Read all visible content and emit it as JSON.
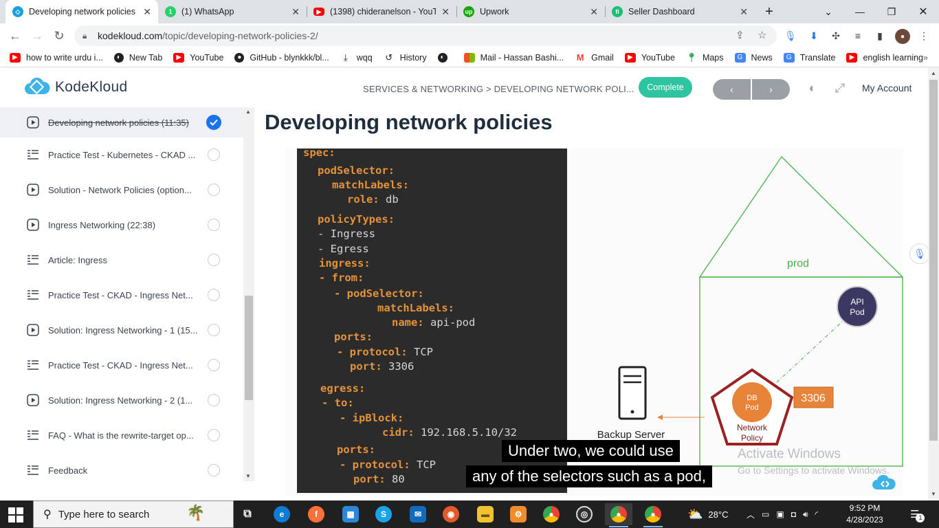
{
  "browser": {
    "tabs": [
      {
        "title": "Developing network policies",
        "active": true,
        "icon": "kodekloud-icon",
        "color": "#1a9ee0"
      },
      {
        "title": "(1) WhatsApp",
        "active": false,
        "icon": "whatsapp-icon",
        "color": "#25d366"
      },
      {
        "title": "(1398) chideranelson - YouTu",
        "active": false,
        "icon": "youtube-icon",
        "color": "#ff0000"
      },
      {
        "title": "Upwork",
        "active": false,
        "icon": "upwork-icon",
        "color": "#14a800"
      },
      {
        "title": "Seller Dashboard",
        "active": false,
        "icon": "fiverr-icon",
        "color": "#1dbf73"
      }
    ],
    "url_host": "kodekloud.com",
    "url_path": "/topic/developing-network-policies-2/",
    "bookmarks": [
      {
        "label": "how to write urdu i...",
        "icon": "youtube-icon",
        "color": "#ff0000"
      },
      {
        "label": "New Tab",
        "icon": "globe-icon",
        "color": "#202124"
      },
      {
        "label": "YouTube",
        "icon": "youtube-icon",
        "color": "#ff0000"
      },
      {
        "label": "GitHub - blynkkk/bl...",
        "icon": "github-icon",
        "color": "#202124"
      },
      {
        "label": "wqq",
        "icon": "download-icon",
        "color": "#202124"
      },
      {
        "label": "History",
        "icon": "history-icon",
        "color": "#202124"
      },
      {
        "label": "",
        "icon": "globe-icon",
        "color": "#202124"
      },
      {
        "label": "Mail - Hassan Bashi...",
        "icon": "microsoft-icon",
        "color": "#f25022"
      },
      {
        "label": "Gmail",
        "icon": "gmail-icon",
        "color": "#ea4335"
      },
      {
        "label": "YouTube",
        "icon": "youtube-icon",
        "color": "#ff0000"
      },
      {
        "label": "Maps",
        "icon": "maps-icon",
        "color": "#34a853"
      },
      {
        "label": "News",
        "icon": "news-icon",
        "color": "#4285f4"
      },
      {
        "label": "Translate",
        "icon": "translate-icon",
        "color": "#4285f4"
      },
      {
        "label": "english learning",
        "icon": "youtube-icon",
        "color": "#ff0000"
      }
    ]
  },
  "site": {
    "logo_text": "KodeKloud",
    "breadcrumb": "SERVICES & NETWORKING > DEVELOPING NETWORK POLI...",
    "complete_label": "Complete",
    "prev_label": "‹",
    "next_label": "›",
    "account_label": "My Account",
    "brand_color": "#2ec4a0"
  },
  "sidebar": {
    "items": [
      {
        "label": "Developing network policies (11:35)",
        "type": "video",
        "done": true,
        "active": true
      },
      {
        "label": "Practice Test - Kubernetes - CKAD ...",
        "type": "quiz",
        "done": false
      },
      {
        "label": "Solution - Network Policies (option...",
        "type": "video",
        "done": false
      },
      {
        "label": "Ingress Networking (22:38)",
        "type": "video",
        "done": false
      },
      {
        "label": "Article: Ingress",
        "type": "quiz",
        "done": false
      },
      {
        "label": "Practice Test - CKAD - Ingress Net...",
        "type": "quiz",
        "done": false
      },
      {
        "label": "Solution: Ingress Networking - 1 (15...",
        "type": "video",
        "done": false
      },
      {
        "label": "Practice Test - CKAD - Ingress Net...",
        "type": "quiz",
        "done": false
      },
      {
        "label": "Solution: Ingress Networking - 2 (1...",
        "type": "video",
        "done": false
      },
      {
        "label": "FAQ - What is the rewrite-target op...",
        "type": "quiz",
        "done": false
      },
      {
        "label": "Feedback",
        "type": "quiz",
        "done": false
      }
    ]
  },
  "lesson": {
    "title": "Developing network policies",
    "code": [
      {
        "k": "spec:",
        "v": ""
      },
      {
        "k": "podSelector:",
        "v": ""
      },
      {
        "k": "matchLabels:",
        "v": ""
      },
      {
        "k": "role:",
        "v": " db"
      },
      {
        "k": "policyTypes:",
        "v": ""
      },
      {
        "k": "",
        "v": "- Ingress"
      },
      {
        "k": "",
        "v": "- Egress"
      },
      {
        "k": "ingress:",
        "v": ""
      },
      {
        "k": "- from:",
        "v": ""
      },
      {
        "k": "- podSelector:",
        "v": ""
      },
      {
        "k": "matchLabels:",
        "v": ""
      },
      {
        "k": "name:",
        "v": " api-pod"
      },
      {
        "k": "ports:",
        "v": ""
      },
      {
        "k": "- protocol:",
        "v": " TCP"
      },
      {
        "k": "port:",
        "v": " 3306"
      },
      {
        "k": "egress:",
        "v": ""
      },
      {
        "k": "- to:",
        "v": ""
      },
      {
        "k": "- ipBlock:",
        "v": ""
      },
      {
        "k": "cidr:",
        "v": " 192.168.5.10/32"
      },
      {
        "k": "ports:",
        "v": ""
      },
      {
        "k": "- protocol:",
        "v": " TCP"
      },
      {
        "k": "port:",
        "v": " 80"
      }
    ],
    "diagram": {
      "namespace_label": "prod",
      "api_pod_label_1": "API",
      "api_pod_label_2": "Pod",
      "db_pod_label_1": "DB",
      "db_pod_label_2": "Pod",
      "policy_label_1": "Network",
      "policy_label_2": "Policy",
      "port_label": "3306",
      "backup_label": "Backup Server"
    },
    "caption_line1": "Under two, we could use",
    "caption_line2": "any of the selectors such as a pod,",
    "watermark_title": "Activate Windows",
    "watermark_sub": "Go to Settings to activate Windows."
  },
  "taskbar": {
    "search_placeholder": "Type here to search",
    "weather": "28°C",
    "time": "9:52 PM",
    "date": "4/28/2023",
    "notifications": "1"
  }
}
